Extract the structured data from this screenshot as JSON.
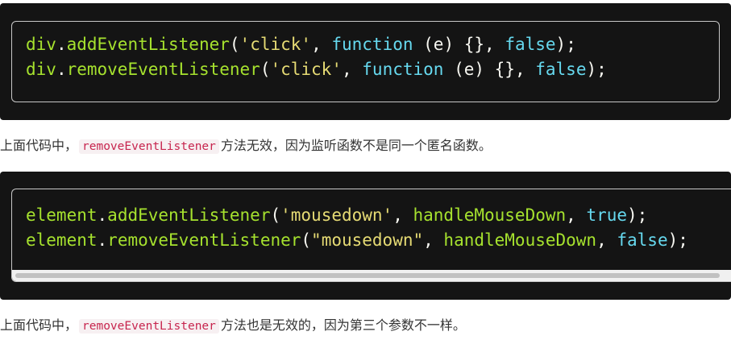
{
  "code_block_1": {
    "line_1": {
      "obj": "div",
      "dot": ".",
      "method": "addEventListener",
      "open": "(",
      "event": "'click'",
      "sep1": ", ",
      "kw_function": "function",
      "params": " (e) {}",
      "sep2": ", ",
      "flag": "false",
      "close": ");"
    },
    "line_2": {
      "obj": "div",
      "dot": ".",
      "method": "removeEventListener",
      "open": "(",
      "event": "'click'",
      "sep1": ", ",
      "kw_function": "function",
      "params": " (e) {}",
      "sep2": ", ",
      "flag": "false",
      "close": ");"
    }
  },
  "paragraph_1": {
    "before": "上面代码中，",
    "code": "removeEventListener",
    "after": "方法无效，因为监听函数不是同一个匿名函数。"
  },
  "code_block_2": {
    "line_1": {
      "obj": "element",
      "dot": ".",
      "method": "addEventListener",
      "open": "(",
      "event": "'mousedown'",
      "sep1": ", ",
      "handler": "handleMouseDown",
      "sep2": ", ",
      "flag": "true",
      "close": ");"
    },
    "line_2": {
      "obj": "element",
      "dot": ".",
      "method": "removeEventListener",
      "open": "(",
      "event": "\"mousedown\"",
      "sep1": ", ",
      "handler": "handleMouseDown",
      "sep2": ", ",
      "flag": "false",
      "close": ");"
    }
  },
  "paragraph_2": {
    "before": "上面代码中，",
    "code": "removeEventListener",
    "after": "方法也是无效的，因为第三个参数不一样。"
  },
  "colors": {
    "code_background": "#141414",
    "identifier": "#a6e22e",
    "string": "#e6db74",
    "keyword": "#66d9ef",
    "inline_code": "#c7254e"
  }
}
